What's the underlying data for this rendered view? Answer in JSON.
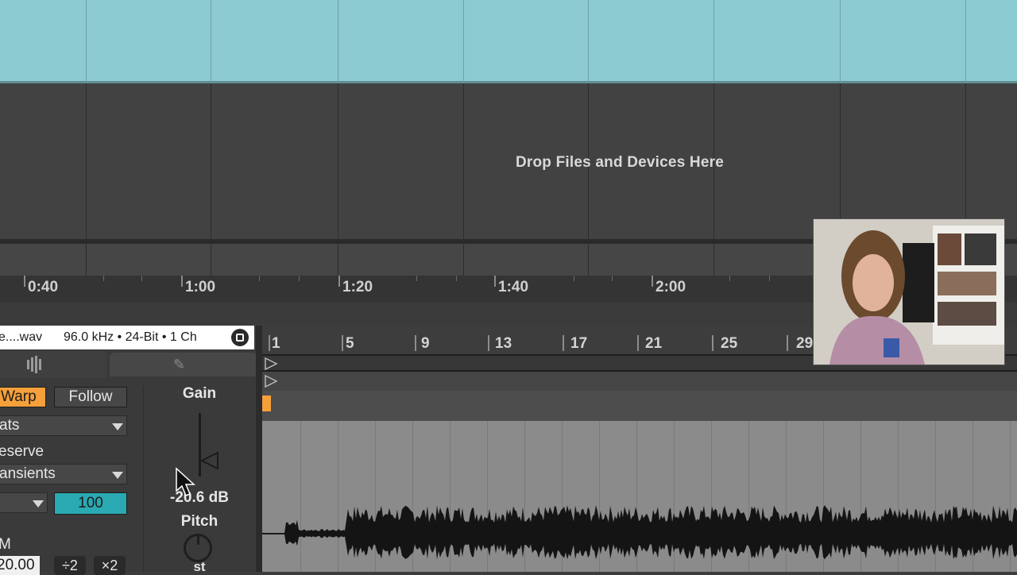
{
  "arrangement": {
    "drop_hint": "Drop Files and Devices Here",
    "time_ruler": {
      "labels": [
        "0:40",
        "1:00",
        "1:20",
        "1:40",
        "2:00"
      ]
    }
  },
  "clip": {
    "file_name": "e....wav",
    "file_props": "96.0 kHz • 24-Bit • 1 Ch",
    "warp_label": "Warp",
    "follow_label": "Follow",
    "warp_mode": "ats",
    "preserve_label": "eserve",
    "preserve_mode": "ansients",
    "grain_dropdown": "",
    "grain_value": "100",
    "bpm_label": "M",
    "bpm_value": "20.00",
    "half_label": "÷2",
    "double_label": "×2",
    "gain_label": "Gain",
    "gain_value": "-20.6 dB",
    "pitch_label": "Pitch",
    "pitch_unit": "st"
  },
  "editor": {
    "beat_labels": [
      "1",
      "5",
      "9",
      "13",
      "17",
      "21",
      "25",
      "29"
    ]
  },
  "colors": {
    "clip_strip": "#8ccbd1",
    "warp_accent": "#f5a03a",
    "value_accent": "#2aa9b3"
  },
  "icons": {
    "save": "save-icon",
    "sample_tab": "waveform-icon",
    "envelope_tab": "pencil-icon",
    "knob": "pitch-knob"
  }
}
